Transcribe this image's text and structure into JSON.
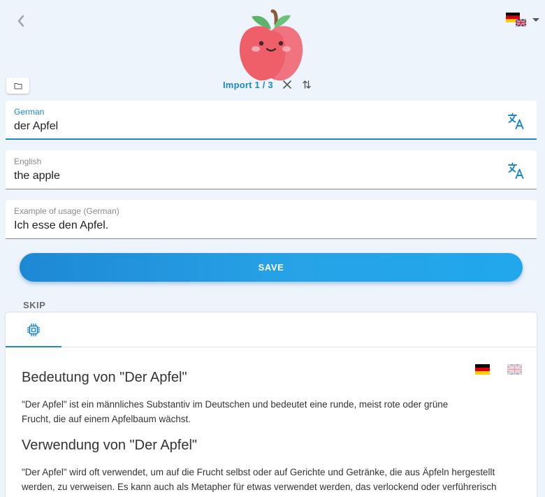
{
  "header": {
    "import_label": "Import 1 / 3"
  },
  "fields": {
    "german": {
      "label": "German",
      "value": "der Apfel"
    },
    "english": {
      "label": "English",
      "value": "the apple"
    },
    "example": {
      "label": "Example of usage (German)",
      "value": "Ich esse den Apfel."
    }
  },
  "actions": {
    "save_label": "SAVE",
    "skip_label": "SKIP"
  },
  "explanation": {
    "heading_meaning": "Bedeutung von \"Der Apfel\"",
    "text_meaning": "\"Der Apfel\" ist ein männliches Substantiv im Deutschen und bedeutet eine runde, meist rote oder grüne Frucht, die auf einem Apfelbaum wächst.",
    "heading_usage": "Verwendung von \"Der Apfel\"",
    "text_usage": "\"Der Apfel\" wird oft verwendet, um auf die Frucht selbst oder auf Gerichte und Getränke, die aus Äpfeln hergestellt werden, zu verweisen. Es kann auch als Metapher für etwas verwendet werden, das verlockend oder verführerisch"
  },
  "icons": {
    "back": "chevron-left-icon",
    "folder": "folder-icon",
    "close": "close-icon",
    "swap": "swap-vertical-icon",
    "translate": "translate-icon",
    "ai_tab": "chip-icon",
    "apple": "apple-mascot-icon"
  },
  "colors": {
    "accent": "#1e88c7",
    "background": "#eef4fb",
    "save_button": "#27a3e8"
  }
}
